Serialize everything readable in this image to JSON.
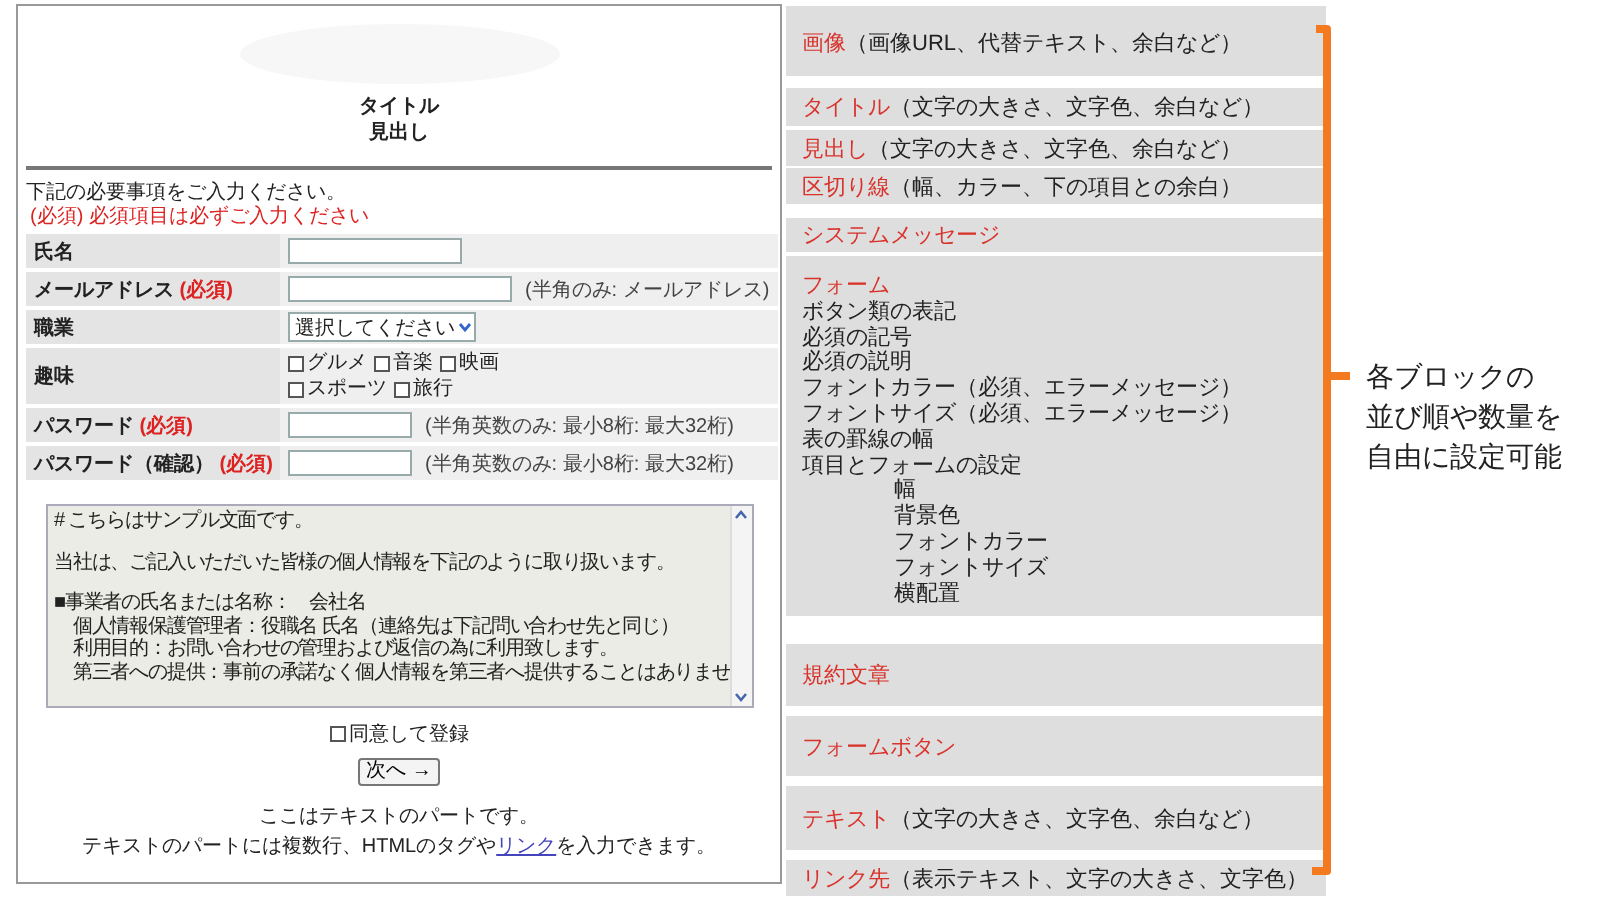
{
  "preview": {
    "title": "タイトル",
    "heading": "見出し",
    "intro": "下記の必要事項をご入力ください。",
    "required_note": "(必須) 必須項目は必ずご入力ください",
    "fields": [
      {
        "label": "氏名",
        "kind": "text"
      },
      {
        "label": "メールアドレス",
        "required_mark": "(必須)",
        "kind": "text",
        "hint": "(半角のみ: メールアドレス)"
      },
      {
        "label": "職業",
        "kind": "select",
        "value": "選択してください"
      },
      {
        "label": "趣味",
        "kind": "checkboxes",
        "options": [
          {
            "label": "グルメ",
            "checked": false
          },
          {
            "label": "音楽",
            "checked": false
          },
          {
            "label": "映画",
            "checked": false
          },
          {
            "label": "スポーツ",
            "checked": false
          },
          {
            "label": "旅行",
            "checked": false
          }
        ]
      },
      {
        "label": "パスワード",
        "required_mark": "(必須)",
        "kind": "password",
        "hint": "(半角英数のみ: 最小8桁: 最大32桁)"
      },
      {
        "label": "パスワード（確認）",
        "required_mark": "(必須)",
        "kind": "password",
        "hint": "(半角英数のみ: 最小8桁: 最大32桁)"
      }
    ],
    "terms": {
      "paragraphs": [
        [
          "# こちらはサンプル文面です。"
        ],
        [
          "当社は、ご記入いただいた皆様の個人情報を下記のように取り扱います。"
        ],
        [
          "■事業者の氏名または名称：　会社名",
          "　個人情報保護管理者：役職名 氏名（連絡先は下記問い合わせ先と同じ）",
          "　利用目的：お問い合わせの管理および返信の為に利用致します。",
          "　第三者への提供：事前の承諾なく個人情報を第三者へ提供することはありませ"
        ]
      ]
    },
    "agree": {
      "label": "同意して登録",
      "checked": false
    },
    "next_button": "次へ →",
    "text_part": {
      "line_1": "ここはテキストのパートです。",
      "before_link": "テキストのパートには複数行、HTMLのタグや",
      "link": "リンク",
      "after_link": "を入力できます。"
    }
  },
  "blocks": [
    {
      "label": "画像",
      "detail": "（画像URL、代替テキスト、余白など）"
    },
    {
      "label": "タイトル",
      "detail": "（文字の大きさ、文字色、余白など）"
    },
    {
      "label": "見出し",
      "detail": "（文字の大きさ、文字色、余白など）"
    },
    {
      "label": "区切り線",
      "detail": "（幅、カラー、下の項目との余白）"
    },
    {
      "label": "システムメッセージ"
    },
    {
      "label": "フォーム",
      "items": [
        {
          "text": "ボタン類の表記"
        },
        {
          "text": "必須の記号"
        },
        {
          "text": "必須の説明"
        },
        {
          "text": "フォントカラー（必須、エラーメッセージ）"
        },
        {
          "text": "フォントサイズ（必須、エラーメッセージ）"
        },
        {
          "text": "表の罫線の幅"
        },
        {
          "text": "項目とフォームの設定",
          "children": [
            {
              "text": "幅"
            },
            {
              "text": "背景色"
            },
            {
              "text": "フォントカラー"
            },
            {
              "text": "フォントサイズ"
            },
            {
              "text": "横配置"
            }
          ]
        }
      ]
    },
    {
      "label": "規約文章"
    },
    {
      "label": "フォームボタン"
    },
    {
      "label": "テキスト",
      "detail": "（文字の大きさ、文字色、余白など）"
    },
    {
      "label": "リンク先",
      "detail": "（表示テキスト、文字の大きさ、文字色）"
    }
  ],
  "callout": {
    "lines": [
      "各ブロックの",
      "並び順や数量を",
      "自由に設定可能"
    ]
  }
}
